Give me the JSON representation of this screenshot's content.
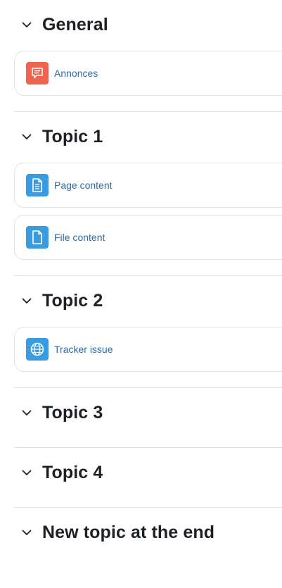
{
  "sections": [
    {
      "title": "General",
      "activities": [
        {
          "name": "Annonces",
          "icon": "forum-icon",
          "color": "#f0634f"
        }
      ]
    },
    {
      "title": "Topic 1",
      "activities": [
        {
          "name": "Page content",
          "icon": "page-icon",
          "color": "#399be2"
        },
        {
          "name": "File content",
          "icon": "file-icon",
          "color": "#399be2"
        }
      ]
    },
    {
      "title": "Topic 2",
      "activities": [
        {
          "name": "Tracker issue",
          "icon": "globe-icon",
          "color": "#399be2"
        }
      ]
    },
    {
      "title": "Topic 3",
      "activities": []
    },
    {
      "title": "Topic 4",
      "activities": []
    },
    {
      "title": "New topic at the end",
      "activities": []
    }
  ],
  "colors": {
    "link": "#2a6ca8",
    "heading": "#1d2125",
    "border": "#dee2e6",
    "forum_icon_bg": "#f0634f",
    "content_icon_bg": "#399be2"
  }
}
